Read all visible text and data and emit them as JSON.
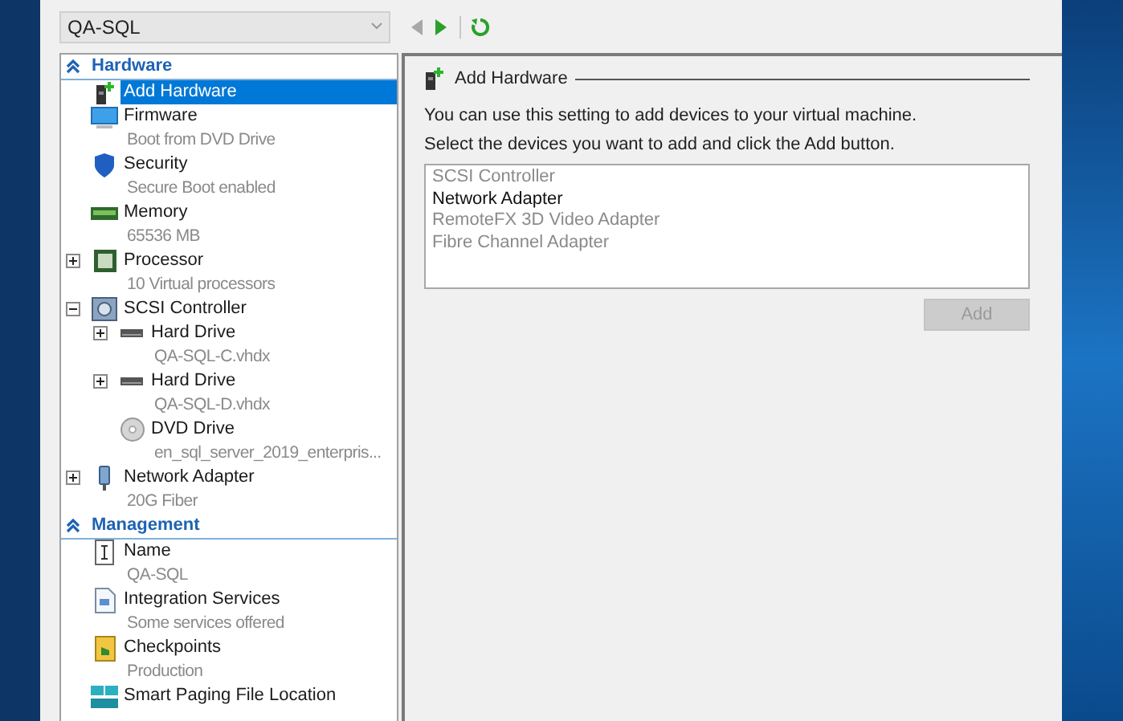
{
  "vm_selector": {
    "value": "QA-SQL"
  },
  "nav": [
    {
      "kind": "back",
      "disabled": true
    },
    {
      "kind": "forward",
      "disabled": false
    },
    {
      "kind": "refresh",
      "disabled": false
    }
  ],
  "sections": [
    {
      "title": "Hardware",
      "expanded": true,
      "items": [
        {
          "label": "Add Hardware",
          "selected": true
        },
        {
          "label": "Firmware",
          "detail": "Boot from DVD Drive",
          "selected": false
        },
        {
          "label": "Security",
          "detail": "Secure Boot enabled",
          "selected": false
        },
        {
          "label": "Memory",
          "detail": "65536 MB",
          "selected": false
        },
        {
          "label": "Processor",
          "detail": "10 Virtual processors",
          "selected": false,
          "expanded": false
        },
        {
          "label": "SCSI Controller",
          "selected": false,
          "expanded": true,
          "children": [
            {
              "label": "Hard Drive",
              "detail": "QA-SQL-C.vhdx",
              "selected": false,
              "expanded": false
            },
            {
              "label": "Hard Drive",
              "detail": "QA-SQL-D.vhdx",
              "selected": false,
              "expanded": false
            },
            {
              "label": "DVD Drive",
              "detail": "en_sql_server_2019_enterpris...",
              "selected": false
            }
          ]
        },
        {
          "label": "Network Adapter",
          "detail": "20G Fiber",
          "selected": false,
          "expanded": false
        }
      ]
    },
    {
      "title": "Management",
      "expanded": true,
      "items": [
        {
          "label": "Name",
          "detail": "QA-SQL",
          "selected": false
        },
        {
          "label": "Integration Services",
          "detail": "Some services offered",
          "selected": false
        },
        {
          "label": "Checkpoints",
          "detail": "Production",
          "selected": false
        },
        {
          "label": "Smart Paging File Location",
          "selected": false
        }
      ]
    }
  ],
  "panel": {
    "title": "Add Hardware",
    "intro": "You can use this setting to add devices to your virtual machine.",
    "instruction": "Select the devices you want to add and click the Add button.",
    "devices": [
      {
        "label": "SCSI Controller",
        "disabled": true
      },
      {
        "label": "Network Adapter",
        "disabled": false
      },
      {
        "label": "RemoteFX 3D Video Adapter",
        "disabled": true
      },
      {
        "label": "Fibre Channel Adapter",
        "disabled": true
      }
    ],
    "add_button": {
      "label": "Add",
      "disabled": true
    }
  }
}
